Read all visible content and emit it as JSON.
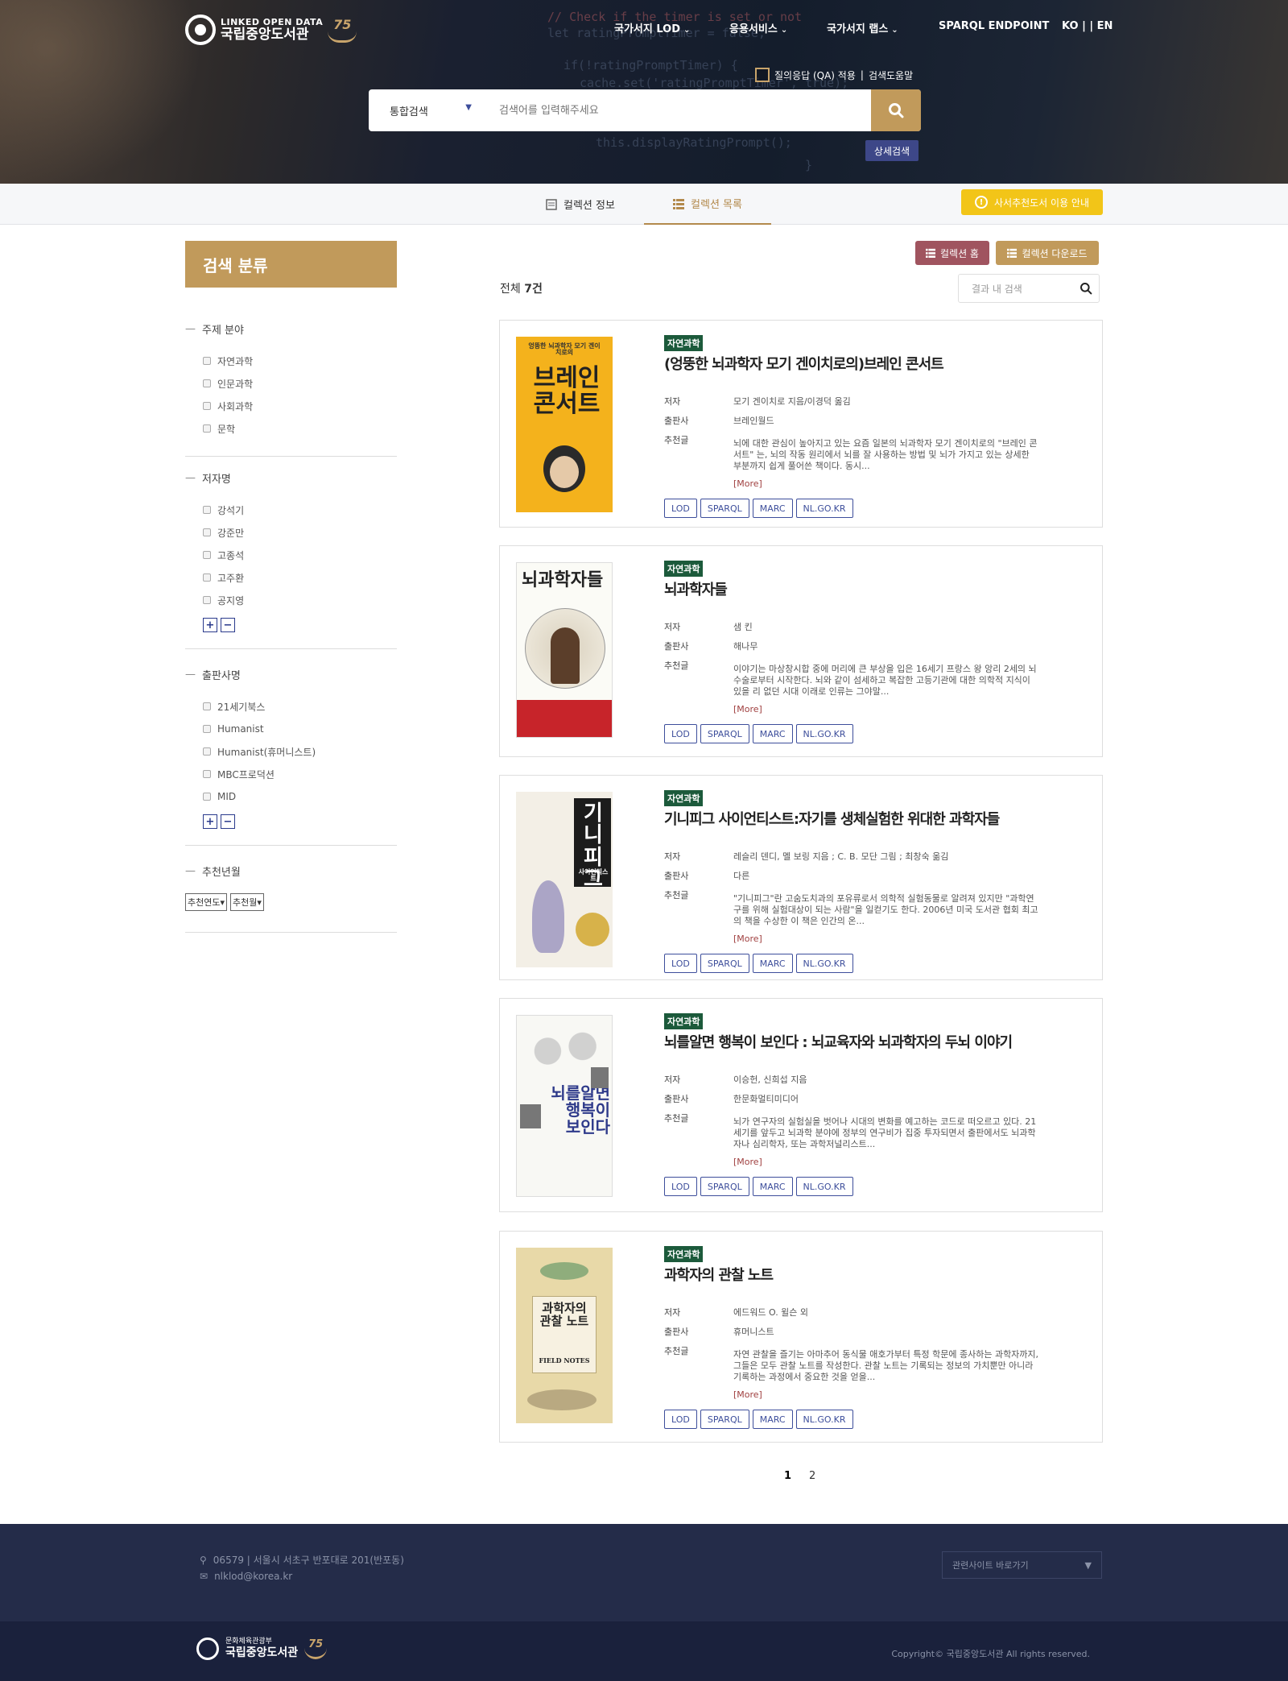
{
  "header": {
    "logo_line1": "LINKED OPEN DATA",
    "logo_line2": "국립중앙도서관",
    "anniversary": "75",
    "nav": [
      {
        "label": "국가서지 LOD"
      },
      {
        "label": "응용서비스"
      },
      {
        "label": "국가서지 랩스"
      },
      {
        "label": "SPARQL ENDPOINT"
      }
    ],
    "lang": "KO | | EN",
    "qa_label": "질의응답 (QA) 적용",
    "help_label": "검색도움말",
    "search": {
      "scope": "통합검색",
      "placeholder": "검색어를 입력해주세요"
    },
    "advanced_label": "상세검색"
  },
  "tabs": {
    "info": "컬렉션 정보",
    "list": "컬렉션 목록",
    "guide": "사서추천도서 이용 안내"
  },
  "sidebar": {
    "heading": "검색 분류",
    "facets": [
      {
        "title": "주제 분야",
        "options": [
          "자연과학",
          "인문과학",
          "사회과학",
          "문학"
        ]
      },
      {
        "title": "저자명",
        "options": [
          "강석기",
          "강준만",
          "고종석",
          "고주환",
          "공지영"
        ]
      },
      {
        "title": "출판사명",
        "options": [
          "21세기북스",
          "Humanist",
          "Humanist(휴머니스트)",
          "MBC프로덕션",
          "MID"
        ]
      },
      {
        "title": "추천년월",
        "selects": [
          "추천연도▾",
          "추천월▾"
        ]
      }
    ]
  },
  "actions": {
    "home": "컬렉션 홈",
    "download": "컬렉션 다운로드"
  },
  "results": {
    "total_prefix": "전체 ",
    "total_count": "7건",
    "in_search_placeholder": "결과 내 검색",
    "labels": {
      "author": "저자",
      "publisher": "출판사",
      "recommend": "추천글",
      "more": "[More]"
    },
    "link_labels": [
      "LOD",
      "SPARQL",
      "MARC",
      "NL.GO.KR"
    ],
    "items": [
      {
        "category": "자연과학",
        "title": "(엉뚱한 뇌과학자 모기 겐이치로의)브레인 콘서트",
        "author": "모기 겐이치로 지음/이경덕 옮김",
        "publisher": "브레인월드",
        "recommend": "뇌에 대한 관심이 높아지고 있는 요즘 일본의 뇌과학자 모기 겐이치로의 \"브레인 콘서트\" 는, 뇌의 작동 원리에서 뇌를 잘 사용하는 방법 및 뇌가 가지고 있는 상세한 부분까지 쉽게 풀어쓴 책이다. 동시...",
        "cover_text": "브레인 콘서트",
        "cover_top": "엉뚱한 뇌과학자 모기 겐이치로의"
      },
      {
        "category": "자연과학",
        "title": "뇌과학자들",
        "author": "샘 킨",
        "publisher": "해나무",
        "recommend": "이야기는 마상창시합 중에 머리에 큰 부상을 입은 16세기 프랑스 왕 앙리 2세의 뇌수술로부터 시작한다. 뇌와 같이 섬세하고 복잡한 고등기관에 대한 의학적 지식이 있을 리 없던 시대 이래로 인류는 그야말...",
        "cover_text": "뇌과학자들"
      },
      {
        "category": "자연과학",
        "title": "기니피그 사이언티스트:자기를 생체실험한 위대한 과학자들",
        "author": "레슬리 덴디, 멜 보링 지음 ; C. B. 모단 그림 ; 최창숙 옮김",
        "publisher": "다른",
        "recommend": "\"기니피그\"란 고숨도치과의 포유류로서 의학적 실험동물로 알려져 있지만 \"과학연구를 위해 실험대상이 되는 사람\"을 일컫기도 한다. 2006년 미국 도서관 협회 최고의 책을 수상한 이 책은 인간의 온...",
        "cover_text": "기니 피그",
        "cover_sub": "사이언티스트"
      },
      {
        "category": "자연과학",
        "title": "뇌를알면 행복이 보인다 : 뇌교육자와 뇌과학자의 두뇌 이야기",
        "author": "이승헌, 신희섭 지음",
        "publisher": "한문화멀티미디어",
        "recommend": "뇌가 연구자의 실험실을 벗어나 시대의 변화를 예고하는 코드로 떠오르고 있다. 21세기를 앞두고 뇌과학 분야에 정부의 연구비가 집중 투자되면서 출판에서도 뇌과학자나 심리학자, 또는 과학저널리스트...",
        "cover_text": "뇌를알면 행복이 보인다"
      },
      {
        "category": "자연과학",
        "title": "과학자의 관찰 노트",
        "author": "에드워드 O. 윌슨 외",
        "publisher": "휴머니스트",
        "recommend": "자연 관찰을 즐기는 아마추어 동식물 애호가부터 특정 학문에 종사하는 과학자까지, 그들은 모두 관찰 노트를 작성한다. 관찰 노트는 기록되는 정보의 가치뿐만 아니라 기록하는 과정에서 중요한 것을 얻을...",
        "cover_text": "과학자의 관찰 노트",
        "cover_sub": "FIELD NOTES"
      }
    ]
  },
  "pagination": {
    "pages": [
      "1",
      "2"
    ],
    "current": "1"
  },
  "footer": {
    "address": "06579 | 서울시 서초구 반포대로 201(반포동)",
    "email": "nlklod@korea.kr",
    "related_sites": "관련사이트 바로가기",
    "ministry": "문화체육관광부",
    "library": "국립중앙도서관",
    "copyright": "Copyright© 국립중앙도서관 All rights reserved."
  },
  "colors": {
    "gold": "#c19a5b",
    "navy": "#242c49",
    "category_green": "#1c5a3b",
    "link_blue": "#3d4e9b",
    "home_button": "#a0545f",
    "guide_yellow": "#f2c518"
  }
}
